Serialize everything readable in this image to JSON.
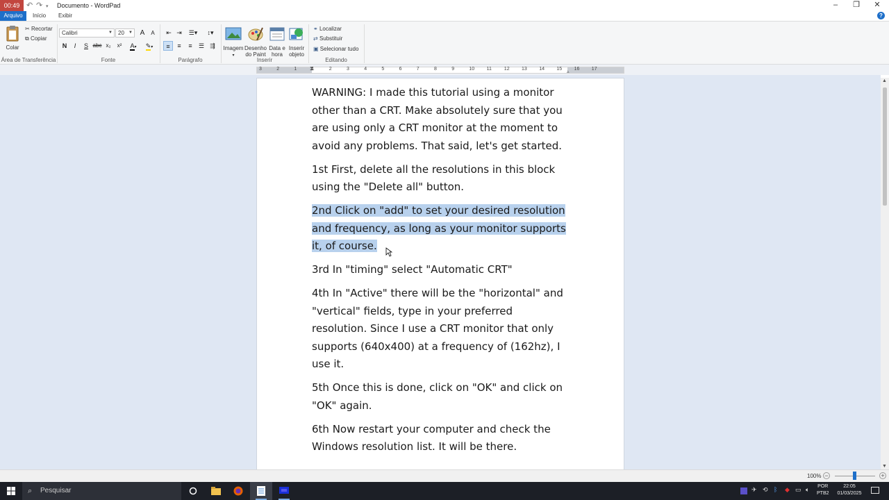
{
  "titlebar": {
    "recording_time": "00:49",
    "title": "Documento - WordPad",
    "minimize_icon": "minimize-icon",
    "restore_icon": "restore-icon",
    "close_icon": "close-icon"
  },
  "tabs": [
    {
      "label": "Arquivo"
    },
    {
      "label": "Início"
    },
    {
      "label": "Exibir"
    }
  ],
  "ribbon": {
    "clipboard": {
      "paste_label": "Colar",
      "cut_label": "Recortar",
      "copy_label": "Copiar",
      "group_label": "Área de Transferência"
    },
    "font": {
      "family": "Calibri",
      "size": "20",
      "bold": "N",
      "italic": "I",
      "underline": "S",
      "strike": "abc",
      "subscript": "x₂",
      "superscript": "x²",
      "grow": "A",
      "shrink": "A",
      "color_glyph": "A",
      "group_label": "Fonte"
    },
    "paragraph": {
      "group_label": "Parágrafo"
    },
    "insert": {
      "image_label": "Imagem",
      "paint_label_1": "Desenho",
      "paint_label_2": "do Paint",
      "date_label_1": "Data e",
      "date_label_2": "hora",
      "object_label_1": "Inserir",
      "object_label_2": "objeto",
      "group_label": "Inserir"
    },
    "editing": {
      "find_label": "Localizar",
      "replace_label": "Substituir",
      "select_all_label": "Selecionar tudo",
      "group_label": "Editando"
    }
  },
  "ruler": {
    "numbers": [
      "3",
      "2",
      "1",
      "1",
      "2",
      "3",
      "4",
      "5",
      "6",
      "7",
      "8",
      "9",
      "10",
      "11",
      "12",
      "13",
      "14",
      "15",
      "16",
      "17"
    ]
  },
  "document": {
    "paragraphs": [
      {
        "text": "WARNING: I made this tutorial using a monitor other than a CRT. Make absolutely sure that you are using only a CRT monitor at the moment to avoid any problems. That said, let's get started.",
        "selected": false
      },
      {
        "text": "1st First, delete all the resolutions in this block using the \"Delete all\" button.",
        "selected": false
      },
      {
        "text": "2nd Click on \"add\" to set your desired resolution and frequency, as long as your monitor supports it, of course.",
        "selected": true
      },
      {
        "text": "3rd In \"timing\" select \"Automatic CRT\"",
        "selected": false
      },
      {
        "text": "4th In \"Active\" there will be the \"horizontal\" and \"vertical\" fields, type in your preferred resolution. Since I use a CRT monitor that only supports (640x400) at a frequency of (162hz), I use it.",
        "selected": false
      },
      {
        "text": "5th Once this is done, click on \"OK\" and click on \"OK\" again.",
        "selected": false
      },
      {
        "text": "6th Now restart your computer and check the Windows resolution list. It will be there.",
        "selected": false
      }
    ]
  },
  "statusbar": {
    "zoom": "100%",
    "zoom_level": 1.0
  },
  "taskbar": {
    "search_placeholder": "Pesquisar",
    "lang_1": "POR",
    "lang_2": "PTB2",
    "time": "22:05",
    "date": "01/03/2025"
  },
  "colors": {
    "accent": "#1e6fc9",
    "selection": "#b8d1ed",
    "doc_background": "#dfe7f3"
  }
}
